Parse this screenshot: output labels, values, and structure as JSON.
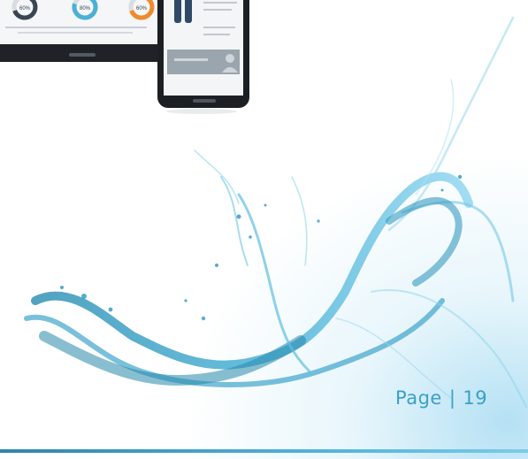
{
  "footer": {
    "page_word": "Page",
    "separator": "|",
    "page_number": "19"
  },
  "devices": {
    "tablet_gauges": [
      "60%",
      "80%",
      "60%"
    ],
    "gauge_colors": [
      "#3a4552",
      "#4bb0d6",
      "#f08a2a"
    ]
  },
  "colors": {
    "accent": "#3aa0c8",
    "splash_dark": "#0e7fa8",
    "splash_light": "#7fd0ee"
  }
}
